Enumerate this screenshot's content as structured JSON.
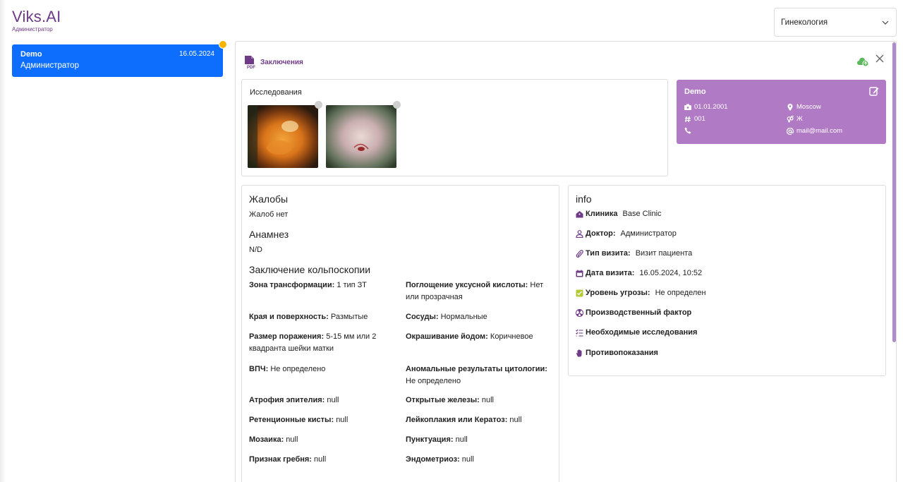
{
  "app": {
    "brand": "Viks.AI",
    "role": "Администратор"
  },
  "specialty_select": {
    "value": "Гинекология"
  },
  "sidebar": {
    "patient": {
      "name": "Demo",
      "date": "16.05.2024",
      "role": "Администратор"
    }
  },
  "toolbar": {
    "pdf_label": "Заключения"
  },
  "studies": {
    "title": "Исследования"
  },
  "patient_info": {
    "name": "Demo",
    "birth_date": "01.01.2001",
    "number": "001",
    "phone": "",
    "city": "Moscow",
    "gender": "Ж",
    "email": "mail@mail.com"
  },
  "complaints": {
    "title": "Жалобы",
    "text": "Жалоб нет"
  },
  "anamnesis": {
    "title": "Анамнез",
    "text": "N/D"
  },
  "colposcopy": {
    "title": "Заключение кольпоскопии",
    "fields": [
      {
        "label": "Зона трансформации:",
        "value": "1 тип ЗТ"
      },
      {
        "label": "Поглощение уксусной кислоты:",
        "value": "Нет или прозрачная"
      },
      {
        "label": "Края и поверхность:",
        "value": "Размытые"
      },
      {
        "label": "Сосуды:",
        "value": "Нормальные"
      },
      {
        "label": "Размер поражения:",
        "value": "5-15 мм или 2 квадранта шейки матки"
      },
      {
        "label": "Окрашивание йодом:",
        "value": "Коричневое"
      },
      {
        "label": "ВПЧ:",
        "value": "Не определено"
      },
      {
        "label": "Аномальные результаты цитологии:",
        "value": "Не определено"
      },
      {
        "label": "Атрофия эпителия:",
        "value": "null"
      },
      {
        "label": "Открытые железы:",
        "value": "null"
      },
      {
        "label": "Ретенционные кисты:",
        "value": "null"
      },
      {
        "label": "Лейкоплакия или Кератоз:",
        "value": "null"
      },
      {
        "label": "Мозаика:",
        "value": "null"
      },
      {
        "label": "Пунктуация:",
        "value": "null"
      },
      {
        "label": "Признак гребня:",
        "value": "null"
      },
      {
        "label": "Эндометриоз:",
        "value": "null"
      }
    ]
  },
  "info": {
    "title": "info",
    "rows": [
      {
        "label": "Клиника",
        "value": "Base Clinic",
        "icon": "clinic-icon"
      },
      {
        "label": "Доктор:",
        "value": "Администратор",
        "icon": "doctor-icon"
      },
      {
        "label": "Тип визита:",
        "value": "Визит пациента",
        "icon": "paperclip-icon"
      },
      {
        "label": "Дата визита:",
        "value": "16.05.2024, 10:52",
        "icon": "calendar-icon"
      },
      {
        "label": "Уровень угрозы:",
        "value": "Не определен",
        "icon": "check-square-icon"
      },
      {
        "label": "Производственный фактор",
        "value": "",
        "icon": "radiation-icon"
      },
      {
        "label": "Необходимые исследования",
        "value": "",
        "icon": "list-check-icon"
      },
      {
        "label": "Противопоказания",
        "value": "",
        "icon": "hand-icon"
      }
    ]
  },
  "colors": {
    "brand": "#6f3a86",
    "accent": "#0d6efd",
    "patient_card": "#b07ac4",
    "badge": "#f7b500"
  }
}
